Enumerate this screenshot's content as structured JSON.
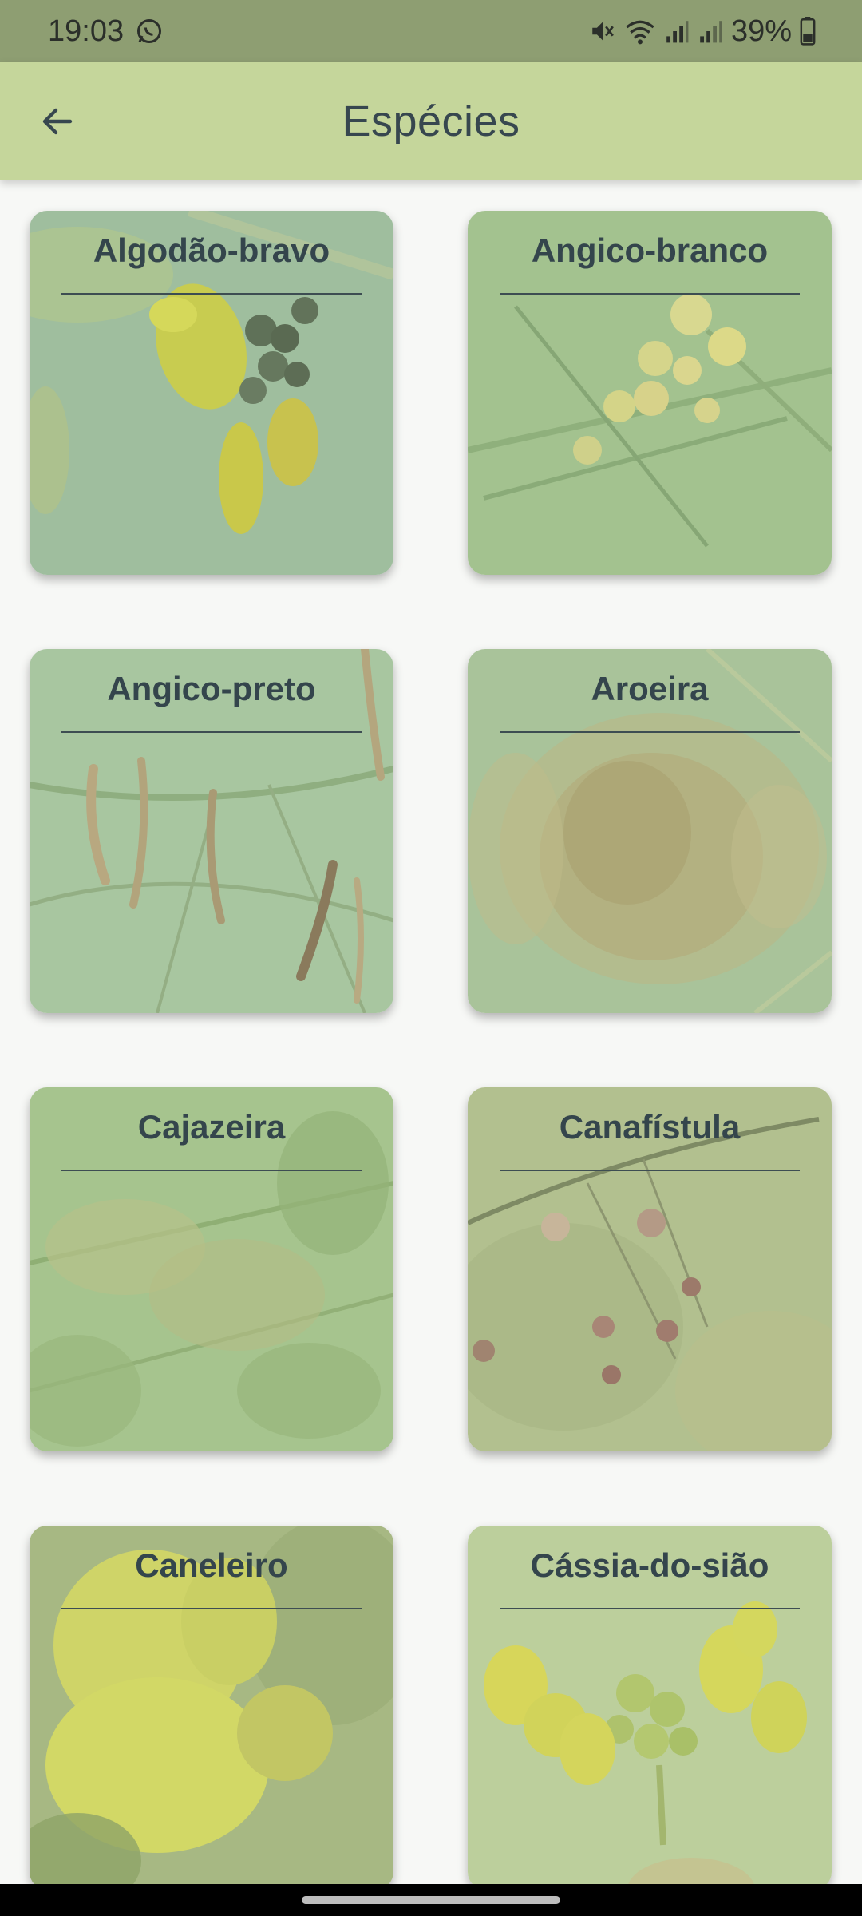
{
  "status_bar": {
    "time": "19:03",
    "battery_percent": "39%",
    "icons": [
      "whatsapp-icon",
      "mute-icon",
      "wifi-icon",
      "signal-icon",
      "signal-icon-2",
      "battery-icon"
    ]
  },
  "app_bar": {
    "title": "Espécies",
    "back_icon": "arrow-left-icon"
  },
  "species": [
    {
      "name": "Algodão-bravo",
      "image": "yellow flowers with dark seed pods"
    },
    {
      "name": "Angico-branco",
      "image": "pale yellow puffball flowers with fern leaves"
    },
    {
      "name": "Angico-preto",
      "image": "hanging brown seed pods on branches"
    },
    {
      "name": "Aroeira",
      "image": "cluster of small yellow-brown flowers"
    },
    {
      "name": "Cajazeira",
      "image": "green leafy branches with flower clusters"
    },
    {
      "name": "Canafístula",
      "image": "thin branches with small red-brown flowers"
    },
    {
      "name": "Caneleiro",
      "image": "large yellow trumpet flower"
    },
    {
      "name": "Cássia-do-sião",
      "image": "bright yellow flower cluster with buds"
    }
  ],
  "colors": {
    "status_bar": "#8e9e72",
    "app_bar": "#c5d69b",
    "title_text": "#37474f",
    "card_overlay": "#c5d69b"
  }
}
